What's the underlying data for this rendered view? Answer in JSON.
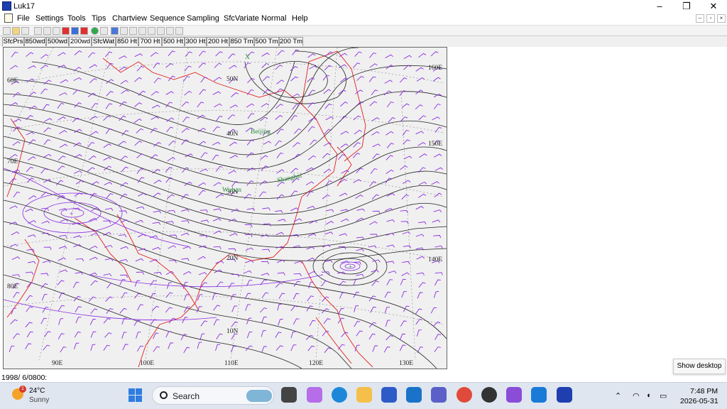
{
  "window": {
    "title": "Luk17",
    "minimize": "–",
    "restore": "❐",
    "close": "✕"
  },
  "menu": [
    "File",
    "Settings",
    "Tools",
    "Tips",
    "Chartview",
    "Sequence",
    "Sampling",
    "SfcVariate",
    "Normal",
    "Help"
  ],
  "mdi_controls": [
    "–",
    "▫",
    "×"
  ],
  "tabs": [
    "SfcPrs",
    "850wd",
    "500wd",
    "200wd",
    "SfcWat",
    "850 Ht",
    "700 Ht",
    "500 Ht",
    "300 Ht",
    "200 Ht",
    "850 Tm",
    "500 Tm",
    "200 Tm"
  ],
  "active_tab": "200wd",
  "map": {
    "lat_labels": [
      "50N",
      "40N",
      "30N",
      "20N",
      "10N"
    ],
    "lon_labels_left": [
      "60E",
      "70E",
      "80E"
    ],
    "lon_labels_right": [
      "160E",
      "150E",
      "140E"
    ],
    "lon_labels_bottom": [
      "90E",
      "100E",
      "110E",
      "120E",
      "130E"
    ],
    "cities": [
      "Beijing",
      "Shanghai",
      "Wuhan"
    ],
    "markers": [
      "X",
      "+"
    ],
    "colors": {
      "isoline": "#222222",
      "wind": "#8a2be2",
      "border": "#e02020",
      "grid": "#888888",
      "city": "#2a8a3a"
    }
  },
  "status": "1998/ 6/0800:",
  "show_desktop": "Show desktop",
  "taskbar": {
    "weather": {
      "temp": "24°C",
      "condition": "Sunny",
      "badge": "1"
    },
    "search_placeholder": "Search",
    "time": "7:48 PM",
    "date": "2026-05-31"
  }
}
